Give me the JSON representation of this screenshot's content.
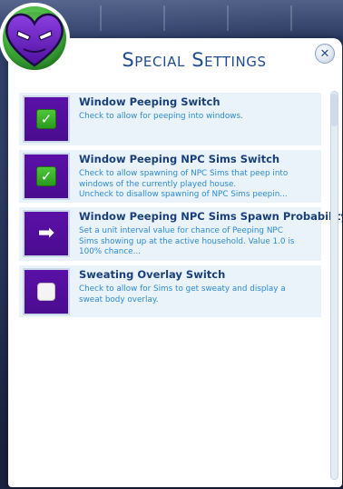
{
  "dialog": {
    "title": "Special Settings",
    "close_glyph": "✕"
  },
  "badge": {
    "icon": "purple-heart-icon",
    "ring_color": "#3fae3a",
    "heart_color": "#6a1fb8"
  },
  "settings": [
    {
      "icon": "checkbox-checked-icon",
      "title": "Window Peeping Switch",
      "description": [
        "Check to allow for peeping into windows."
      ]
    },
    {
      "icon": "checkbox-checked-icon",
      "title": "Window Peeping NPC Sims Switch",
      "description": [
        "Check to allow spawning of NPC Sims that peep into",
        "windows of the currently played house.",
        "Uncheck to disallow spawning of NPC Sims peepin..."
      ]
    },
    {
      "icon": "arrow-right-icon",
      "title": "Window Peeping NPC Sims Spawn Probability",
      "description": [
        "Set a unit interval value for chance of Peeping NPC",
        "Sims showing up at the active household. Value 1.0 is",
        "100% chance..."
      ]
    },
    {
      "icon": "checkbox-unchecked-icon",
      "title": "Sweating Overlay Switch",
      "description": [
        "Check to allow for Sims to get sweaty and display a",
        "sweat body overlay."
      ]
    }
  ],
  "colors": {
    "title": "#1f4c8f",
    "row_title": "#1a3f7a",
    "row_description": "#2e8bd6",
    "row_background": "#e9f3f9",
    "icon_tile": "#5b10a8"
  }
}
